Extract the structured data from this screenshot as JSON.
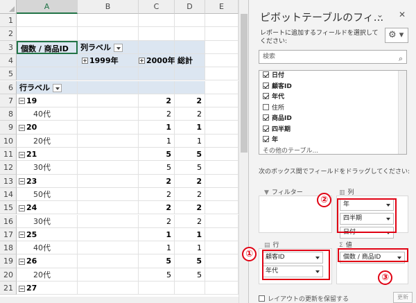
{
  "sheet": {
    "columns": [
      {
        "letter": "A",
        "selected": true
      },
      {
        "letter": "B",
        "selected": false
      },
      {
        "letter": "C",
        "selected": false
      },
      {
        "letter": "D",
        "selected": false
      },
      {
        "letter": "E",
        "selected": false
      }
    ],
    "rows": [
      {
        "num": "1",
        "cells": [
          "",
          "",
          "",
          ""
        ]
      },
      {
        "num": "2",
        "cells": [
          "",
          "",
          "",
          ""
        ]
      },
      {
        "num": "3",
        "kind": "header3",
        "cells": [
          "個数 / 商品ID",
          "列ラベル",
          "",
          ""
        ]
      },
      {
        "num": "4",
        "kind": "header4",
        "cells": [
          "",
          "1999年",
          "2000年",
          "総計"
        ]
      },
      {
        "num": "5",
        "kind": "blank",
        "cells": [
          "",
          "",
          "",
          ""
        ]
      },
      {
        "num": "6",
        "kind": "header6",
        "cells": [
          "行ラベル",
          "",
          "",
          ""
        ]
      },
      {
        "num": "7",
        "kind": "group",
        "cells": [
          "19",
          "",
          "2",
          "2"
        ]
      },
      {
        "num": "8",
        "kind": "detail",
        "cells": [
          "40代",
          "",
          "2",
          "2"
        ]
      },
      {
        "num": "9",
        "kind": "group",
        "cells": [
          "20",
          "",
          "1",
          "1"
        ]
      },
      {
        "num": "10",
        "kind": "detail",
        "cells": [
          "20代",
          "",
          "1",
          "1"
        ]
      },
      {
        "num": "11",
        "kind": "group",
        "cells": [
          "21",
          "",
          "5",
          "5"
        ]
      },
      {
        "num": "12",
        "kind": "detail",
        "cells": [
          "30代",
          "",
          "5",
          "5"
        ]
      },
      {
        "num": "13",
        "kind": "group",
        "cells": [
          "23",
          "",
          "2",
          "2"
        ]
      },
      {
        "num": "14",
        "kind": "detail",
        "cells": [
          "50代",
          "",
          "2",
          "2"
        ]
      },
      {
        "num": "15",
        "kind": "group",
        "cells": [
          "24",
          "",
          "2",
          "2"
        ]
      },
      {
        "num": "16",
        "kind": "detail",
        "cells": [
          "30代",
          "",
          "2",
          "2"
        ]
      },
      {
        "num": "17",
        "kind": "group",
        "cells": [
          "25",
          "",
          "1",
          "1"
        ]
      },
      {
        "num": "18",
        "kind": "detail",
        "cells": [
          "40代",
          "",
          "1",
          "1"
        ]
      },
      {
        "num": "19",
        "kind": "group",
        "cells": [
          "26",
          "",
          "5",
          "5"
        ]
      },
      {
        "num": "20",
        "kind": "detail",
        "cells": [
          "20代",
          "",
          "5",
          "5"
        ]
      },
      {
        "num": "21",
        "kind": "group",
        "cells": [
          "27",
          "",
          "",
          ""
        ]
      }
    ],
    "collapse_glyph": "−",
    "expand_glyph": "+"
  },
  "pane": {
    "title": "ピボットテーブルのフィ...",
    "desc": "レポートに追加するフィールドを選択してください:",
    "search_placeholder": "検索",
    "fields": [
      {
        "label": "日付",
        "checked": true
      },
      {
        "label": "顧客ID",
        "checked": true
      },
      {
        "label": "年代",
        "checked": true
      },
      {
        "label": "住所",
        "checked": false
      },
      {
        "label": "商品ID",
        "checked": true
      },
      {
        "label": "四半期",
        "checked": true
      },
      {
        "label": "年",
        "checked": true
      }
    ],
    "more_tables": "その他のテーブル...",
    "drag_hint": "次のボックス間でフィールドをドラッグしてください:",
    "areas": {
      "filter_label": "フィルター",
      "columns_label": "列",
      "rows_label": "行",
      "values_label": "値",
      "columns_items": [
        "年",
        "四半期",
        "日付"
      ],
      "rows_items": [
        "顧客ID",
        "年代"
      ],
      "values_items": [
        "個数 / 商品ID"
      ]
    },
    "markers": [
      "①",
      "②",
      "③"
    ],
    "defer_label": "レイアウトの更新を保留する",
    "update_label": "更新"
  }
}
